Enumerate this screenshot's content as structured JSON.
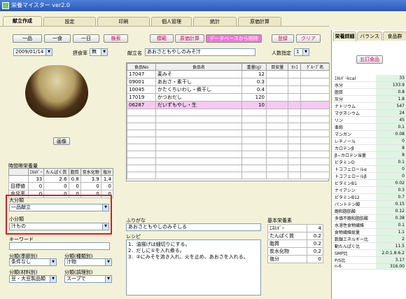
{
  "window": {
    "title": "栄養マイスター ver2.0"
  },
  "tabs": [
    "献立作成",
    "設定",
    "印刷",
    "個人管理",
    "統計",
    "原価計算"
  ],
  "toolbar": {
    "b1": "一品",
    "b2": "一食",
    "b3": "一日",
    "search": "検索",
    "template": "模範",
    "cost": "原価計算",
    "db_delete": "データベースから削除",
    "register": "登録",
    "clear": "クリア"
  },
  "date": "2009/01/14",
  "fulfill_label": "摂食率",
  "fulfill_value": "無",
  "menu_label": "献立名",
  "menu_name": "あおさともやしのみそ汁",
  "servings_label": "人数指定",
  "servings_value": "1",
  "image_button": "画像",
  "food_table": {
    "headers": [
      "食品No",
      "食品名",
      "重量(g)",
      "目安量",
      "ｶｯｺ",
      "ｸﾞﾙｰﾌﾟ名"
    ],
    "rows": [
      [
        "17047",
        "麦みそ",
        "12",
        "",
        ""
      ],
      [
        "09001",
        "あおさ・素干し",
        "0.3",
        "",
        ""
      ],
      [
        "10045",
        "かたくちいわし・煮干し",
        "0.4",
        "",
        ""
      ],
      [
        "17019",
        "かつおだし",
        "120",
        "",
        ""
      ],
      [
        "06287",
        "だいずもやし・生",
        "10",
        "",
        ""
      ]
    ]
  },
  "nutrition_summary": {
    "title": "時間帯栄養量",
    "headers": [
      "",
      "ｴﾈﾙｷﾞｰ",
      "たんぱく質",
      "脂質",
      "炭水化物",
      "塩分"
    ],
    "rows": [
      [
        "",
        "33",
        "2.6",
        "0.8",
        "3.9",
        "1.4"
      ],
      [
        "目標値",
        "0",
        "0",
        "0",
        "0",
        "0"
      ],
      [
        "充足率",
        "0",
        "0",
        "0",
        "0",
        "0"
      ]
    ]
  },
  "class_large": {
    "label": "大分類",
    "value": "一品献立"
  },
  "class_small": {
    "label": "小分類",
    "value": "汁もの"
  },
  "keyword_label": "キーワード",
  "cat_taste": {
    "label": "分類(季節別)",
    "value": "条件なし"
  },
  "cat_kind": {
    "label": "分類(種類別)",
    "value": "汁物"
  },
  "cat_material": {
    "label": "分類(材料別)",
    "value": "豆・大豆製品類"
  },
  "cat_cook": {
    "label": "分類(調理別)",
    "value": "スープで"
  },
  "furigana_label": "ふりがな",
  "furigana": "あおさともやしのみそしる",
  "recipe_label": "レシピ",
  "recipe": [
    "1．油揚げは細切りにする。",
    "2．だしに①を入れ煮る。",
    "3．②にみそを溶き入れ、火を止め、あおさを入れる。"
  ],
  "basic_label": "基本栄養素",
  "basic": [
    [
      "ｴﾈﾙｷﾞｰ",
      "4"
    ],
    [
      "たんぱく質",
      "0.2"
    ],
    [
      "脂質",
      "0.2"
    ],
    [
      "炭水化物",
      "0.2"
    ],
    [
      "塩分",
      "0"
    ]
  ],
  "panel": {
    "tabs": [
      "栄養詳細",
      "バランス",
      "食品群"
    ],
    "food_btn": "五訂食品",
    "items": [
      [
        "ｴﾈﾙｷﾞｰkcal",
        "33"
      ],
      [
        "水分",
        "133.9"
      ],
      [
        "脂質",
        "0.8"
      ],
      [
        "灰分",
        "1.8"
      ],
      [
        "ナトリウム",
        "547"
      ],
      [
        "マグネシウム",
        "24"
      ],
      [
        "リン",
        "45"
      ],
      [
        "亜鉛",
        "0.1"
      ],
      [
        "マンガン",
        "0.08"
      ],
      [
        "レチノール",
        "0"
      ],
      [
        "カロテンβ",
        "8"
      ],
      [
        "β−カロテン当量",
        "8"
      ],
      [
        "ビタミンD",
        "0.1"
      ],
      [
        "トコフェロールα",
        "0"
      ],
      [
        "トコフェロールβ",
        "0"
      ],
      [
        "ビタミンB1",
        "0.02"
      ],
      [
        "ナイアシン",
        "0.3"
      ],
      [
        "ビタミンB12",
        "0.7"
      ],
      [
        "パントテン酸",
        "0.15"
      ],
      [
        "飽和脂肪酸",
        "0.12"
      ],
      [
        "多価不飽和脂肪酸",
        "0.38"
      ],
      [
        "水溶性食物繊維",
        "0.1"
      ],
      [
        "食物繊維総量",
        "1.1"
      ],
      [
        "穀類エネルギー比",
        "2"
      ],
      [
        "動たんぱく比",
        "11.5"
      ],
      [
        "SMP比",
        "2.0:1.8:6.2"
      ],
      [
        "P/S比",
        "3.17"
      ],
      [
        "n-6",
        "316.00"
      ]
    ]
  }
}
